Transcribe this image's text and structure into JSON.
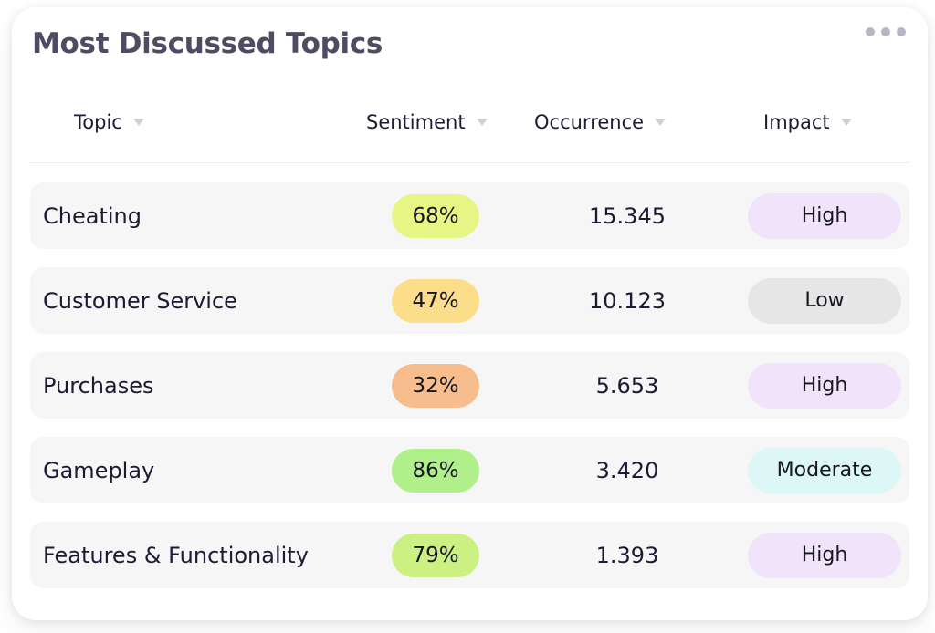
{
  "card": {
    "title": "Most Discussed Topics",
    "menu_icon": "kebab-menu-icon"
  },
  "table": {
    "columns": [
      {
        "label": "Topic",
        "sort_icon": "chevron-down-icon"
      },
      {
        "label": "Sentiment",
        "sort_icon": "chevron-down-icon"
      },
      {
        "label": "Occurrence",
        "sort_icon": "chevron-down-icon"
      },
      {
        "label": "Impact",
        "sort_icon": "chevron-down-icon"
      }
    ],
    "rows": [
      {
        "topic": "Cheating",
        "sentiment": "68%",
        "sentiment_color": "#e7f585",
        "occurrence": "15.345",
        "impact": "High",
        "impact_color": "#f1e3f9"
      },
      {
        "topic": "Customer Service",
        "sentiment": "47%",
        "sentiment_color": "#fcdd8a",
        "occurrence": "10.123",
        "impact": "Low",
        "impact_color": "#e6e6e6"
      },
      {
        "topic": "Purchases",
        "sentiment": "32%",
        "sentiment_color": "#f8bd8c",
        "occurrence": "5.653",
        "impact": "High",
        "impact_color": "#f1e3f9"
      },
      {
        "topic": "Gameplay",
        "sentiment": "86%",
        "sentiment_color": "#b0f08a",
        "occurrence": "3.420",
        "impact": "Moderate",
        "impact_color": "#ddf7f7"
      },
      {
        "topic": "Features & Functionality",
        "sentiment": "79%",
        "sentiment_color": "#ccf081",
        "occurrence": "1.393",
        "impact": "High",
        "impact_color": "#f1e3f9"
      }
    ]
  },
  "theme": {
    "title_color": "#4e4b63",
    "text_color": "#1b1b33",
    "row_bg": "#f6f6f7",
    "card_bg": "#ffffff",
    "caret_color": "#cfcfd6"
  }
}
